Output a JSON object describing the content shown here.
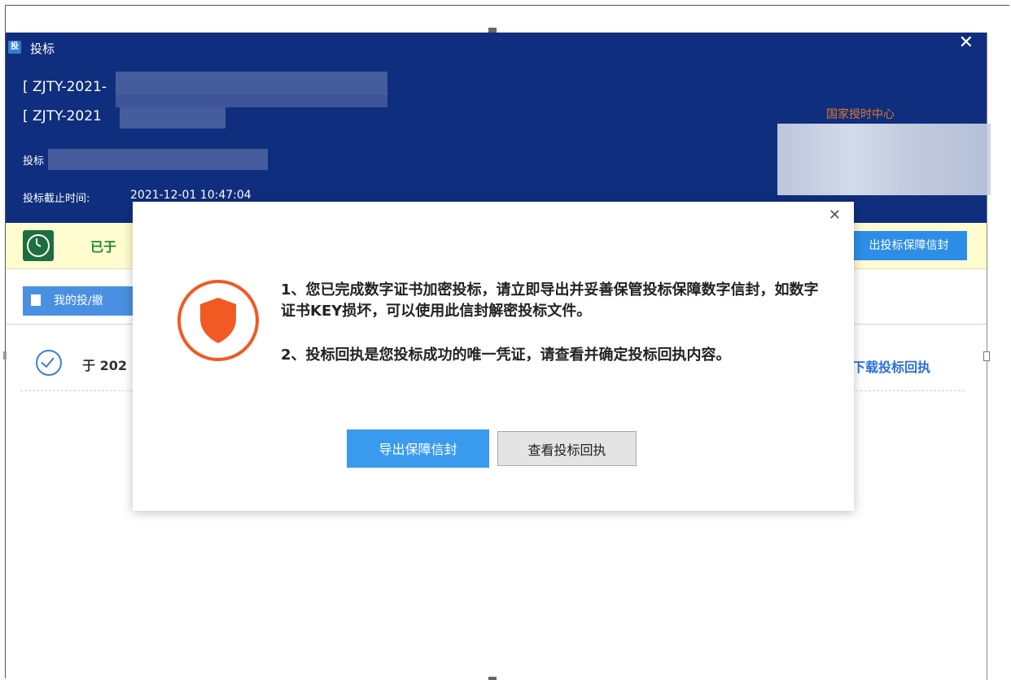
{
  "window": {
    "title": "投标",
    "app_icon_text": "投",
    "close_glyph": "✕"
  },
  "header": {
    "line1": "[ ZJTY-2021-",
    "line2": "[ ZJTY-2021",
    "bid_label": "投标",
    "deadline_label": "投标截止时间:",
    "deadline_value": "2021-12-01 10:47:04",
    "timestamp_center": "国家授时中心"
  },
  "status_bar": {
    "text": "已于",
    "export_button": "出投标保障信封"
  },
  "tabs": {
    "my_bids": "我的投/撤"
  },
  "record_row": {
    "text": "于 202",
    "download_link": "下载投标回执"
  },
  "dialog": {
    "close_glyph": "✕",
    "message1": "1、您已完成数字证书加密投标，请立即导出并妥善保管投标保障数字信封，如数字证书KEY损坏，可以使用此信封解密投标文件。",
    "message2": "2、投标回执是您投标成功的唯一凭证，请查看并确定投标回执内容。",
    "primary_button": "导出保障信封",
    "secondary_button": "查看投标回执"
  },
  "colors": {
    "header_bg": "#0f2e7d",
    "accent_blue": "#3a9aee",
    "shield_orange": "#f15a22",
    "status_green": "#1d8a2a"
  }
}
